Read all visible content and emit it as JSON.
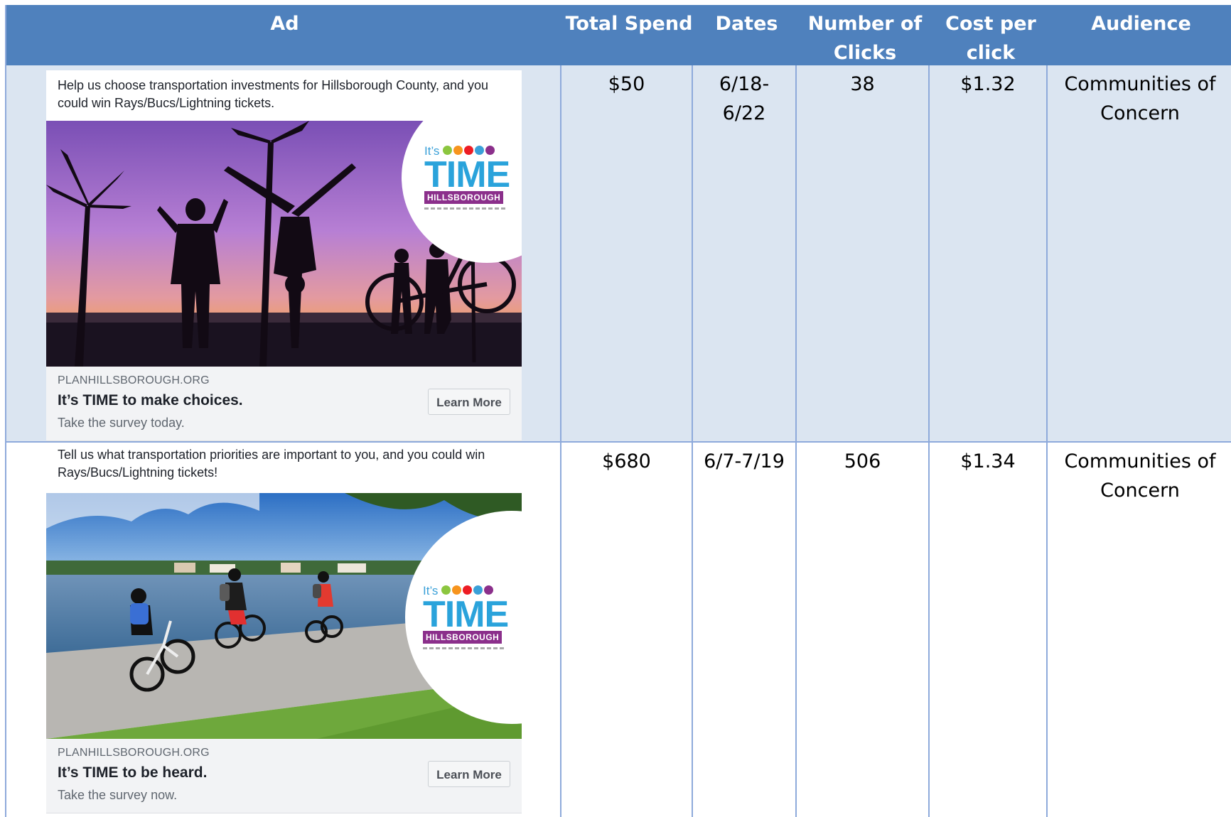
{
  "headers": {
    "ad": "Ad",
    "total_spend": "Total Spend",
    "dates": "Dates",
    "clicks_line1": "Number of",
    "clicks_line2": "Clicks",
    "cpc_line1": "Cost per",
    "cpc_line2": "click",
    "audience": "Audience"
  },
  "rows": [
    {
      "ad": {
        "text_line1": "Help us choose transportation investments for Hillsborough County, and you",
        "text_line2": "could win Rays/Bucs/Lightning tickets.",
        "domain": "PLANHILLSBOROUGH.ORG",
        "headline": "It’s TIME to make choices.",
        "description": "Take the survey today.",
        "button": "Learn More",
        "image_desc": "silhouette-sunset-photo"
      },
      "total_spend": "$50",
      "dates_line1": "6/18-",
      "dates_line2": "6/22",
      "clicks": "38",
      "cost_per_click": "$1.32",
      "audience_line1": "Communities of",
      "audience_line2": "Concern"
    },
    {
      "ad": {
        "text_line1": "Tell us what transportation priorities are important to you, and you could win",
        "text_line2": "Rays/Bucs/Lightning tickets!",
        "domain": "PLANHILLSBOROUGH.ORG",
        "headline": "It’s TIME to be heard.",
        "description": "Take the survey now.",
        "button": "Learn More",
        "image_desc": "kids-biking-waterfront-photo"
      },
      "total_spend": "$680",
      "dates_line1": "6/7-7/19",
      "dates_line2": "",
      "clicks": "506",
      "cost_per_click": "$1.34",
      "audience_line1": "Communities of",
      "audience_line2": "Concern"
    }
  ],
  "logo": {
    "its": "It’s",
    "time": "TIME",
    "hillsborough": "HILLSBOROUGH"
  },
  "colors": {
    "header_bg": "#4f81bd",
    "row_alt_bg": "#dbe5f1",
    "border": "#8eaadb",
    "logo_blue": "#2aa3db",
    "logo_purple": "#8b2f8b"
  }
}
